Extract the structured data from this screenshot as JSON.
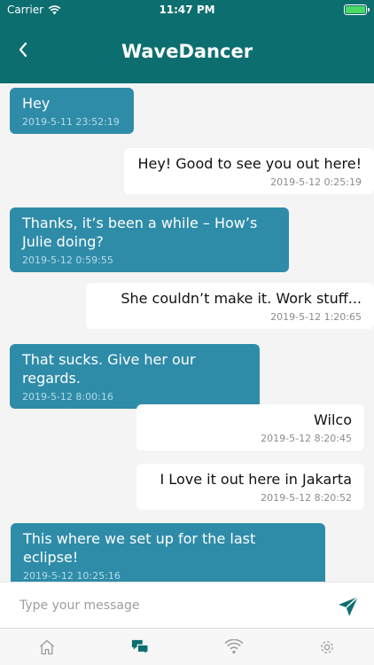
{
  "status_bar": {
    "carrier": "Carrier",
    "time": "11:47 PM"
  },
  "header": {
    "title": "WaveDancer"
  },
  "messages": [
    {
      "direction": "in",
      "text": "Hey",
      "timestamp": "2019-5-11 23:52:19"
    },
    {
      "direction": "out",
      "text": "Hey! Good to see you out here!",
      "timestamp": "2019-5-12 0:25:19"
    },
    {
      "direction": "in",
      "text": "Thanks, it’s been a while – How’s Julie doing?",
      "timestamp": "2019-5-12 0:59:55"
    },
    {
      "direction": "out",
      "text": "She couldn’t make it. Work stuff...",
      "timestamp": "2019-5-12 1:20:65"
    },
    {
      "direction": "in",
      "text": "That sucks. Give her our regards.",
      "timestamp": "2019-5-12 8:00:16"
    },
    {
      "direction": "out",
      "text": "Wilco",
      "timestamp": "2019-5-12 8:20:45"
    },
    {
      "direction": "out",
      "text": "I Love it out here in Jakarta",
      "timestamp": "2019-5-12 8:20:52"
    },
    {
      "direction": "in",
      "text": "This where we set up for the last eclipse!",
      "timestamp": "2019-5-12 10:25:16"
    }
  ],
  "composer": {
    "placeholder": "Type your message",
    "value": ""
  },
  "tabs": [
    {
      "icon": "home-icon",
      "active": false
    },
    {
      "icon": "chat-icon",
      "active": true
    },
    {
      "icon": "wifi-icon",
      "active": false
    },
    {
      "icon": "gear-icon",
      "active": false
    }
  ],
  "colors": {
    "header": "#0d6e70",
    "incoming_bubble": "#2e8ca9",
    "outgoing_bubble": "#ffffff",
    "accent": "#0d6e70",
    "background": "#f4f4f4"
  }
}
